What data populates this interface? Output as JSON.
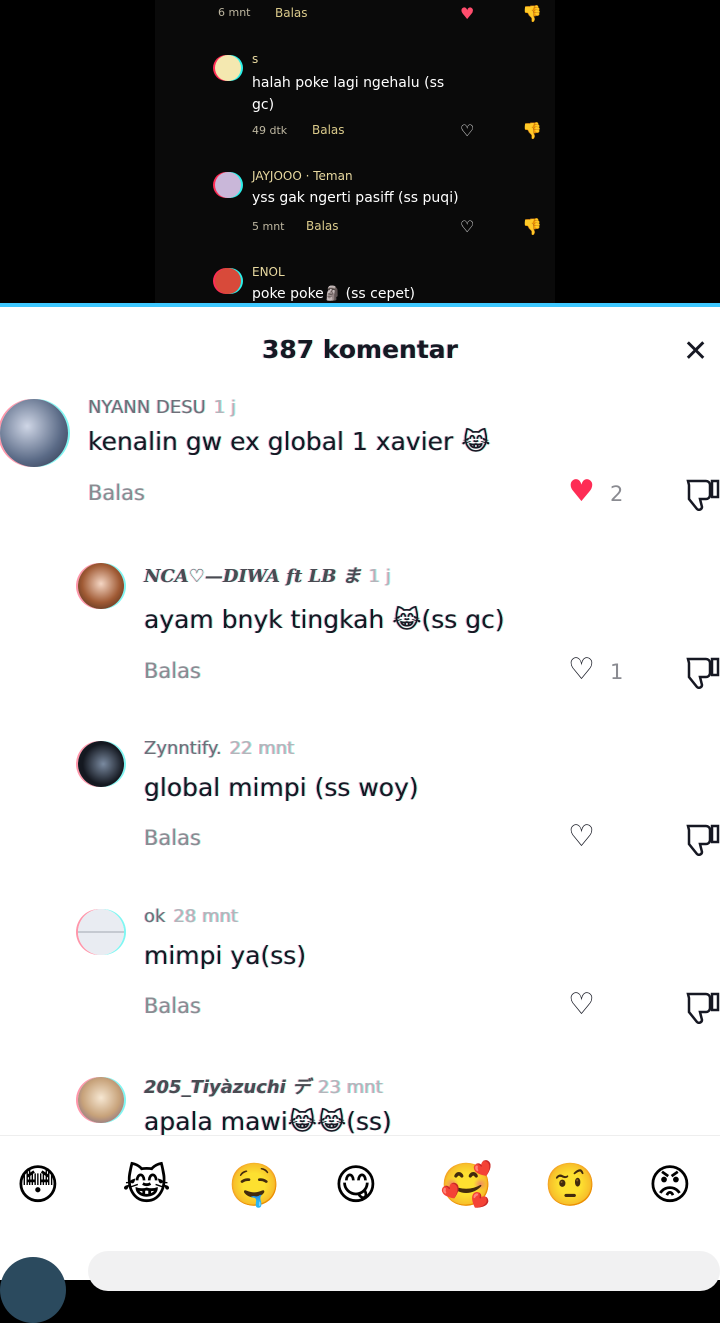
{
  "background_comments": [
    {
      "meta": "6 mnt",
      "balas": "Balas"
    },
    {
      "name": "s",
      "text": "halah poke lagi ngehalu (ss gc)",
      "meta": "49 dtk",
      "balas": "Balas"
    },
    {
      "name": "JAYJOOO · Teman",
      "text": "yss gak ngerti pasiff (ss puqi)",
      "meta": "5 mnt",
      "balas": "Balas"
    },
    {
      "name": "ENOL",
      "text": "poke poke🗿 (ss cepet)"
    }
  ],
  "sheet": {
    "title": "387 komentar",
    "close_icon": "close-icon"
  },
  "comments": [
    {
      "name": "NYANN DESU",
      "time": "1 j",
      "text": "kenalin gw ex global 1 xavier 😹",
      "reply": "Balas",
      "likes": "2",
      "liked": true
    },
    {
      "name": "NCA♡—DIWA ft LB ま",
      "time": "1 j",
      "text": "ayam bnyk tingkah 😹(ss gc)",
      "reply": "Balas",
      "likes": "1",
      "liked": false
    },
    {
      "name": "Zynntify.",
      "time": "22 mnt",
      "text": "global mimpi (ss woy)",
      "reply": "Balas",
      "likes": "",
      "liked": false
    },
    {
      "name": "ok",
      "time": "28 mnt",
      "text": "mimpi ya(ss)",
      "reply": "Balas",
      "likes": "",
      "liked": false
    },
    {
      "name": "205_Tiyàzuchi デ",
      "time": "23 mnt",
      "text": "apala mawi😹😹(ss)"
    }
  ],
  "emojis": [
    "😳",
    "😹",
    "🤤",
    "😋",
    "🥰",
    "🤨",
    "😡"
  ],
  "colors": {
    "like_red": "#fe2c55",
    "text_primary": "#161823",
    "text_secondary": "#8a8b91",
    "glitch_cyan": "#2af0ea",
    "glitch_red": "#ff2d55"
  }
}
